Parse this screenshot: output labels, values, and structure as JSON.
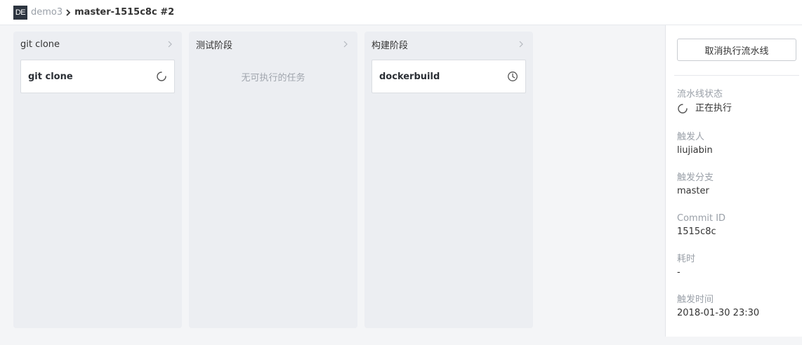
{
  "header": {
    "logo_text": "DE",
    "breadcrumb_parent": "demo3",
    "breadcrumb_current": "master-1515c8c #2"
  },
  "stages": [
    {
      "title": "git clone",
      "job": {
        "name": "git clone",
        "status_icon": "spinner-icon"
      }
    },
    {
      "title": "测试阶段",
      "empty_message": "无可执行的任务"
    },
    {
      "title": "构建阶段",
      "job": {
        "name": "dockerbuild",
        "status_icon": "clock-icon"
      }
    }
  ],
  "sidebar": {
    "cancel_button": "取消执行流水线",
    "status_label": "流水线状态",
    "status_value": "正在执行",
    "trigger_user_label": "触发人",
    "trigger_user": "liujiabin",
    "branch_label": "触发分支",
    "branch": "master",
    "commit_label": "Commit ID",
    "commit": "1515c8c",
    "duration_label": "耗时",
    "duration": "-",
    "trigger_time_label": "触发时间",
    "trigger_time": "2018-01-30 23:30"
  },
  "colors": {
    "page_bg": "#f4f5f7",
    "stage_bg": "#eceef2",
    "logo_bg": "#2d3540"
  }
}
